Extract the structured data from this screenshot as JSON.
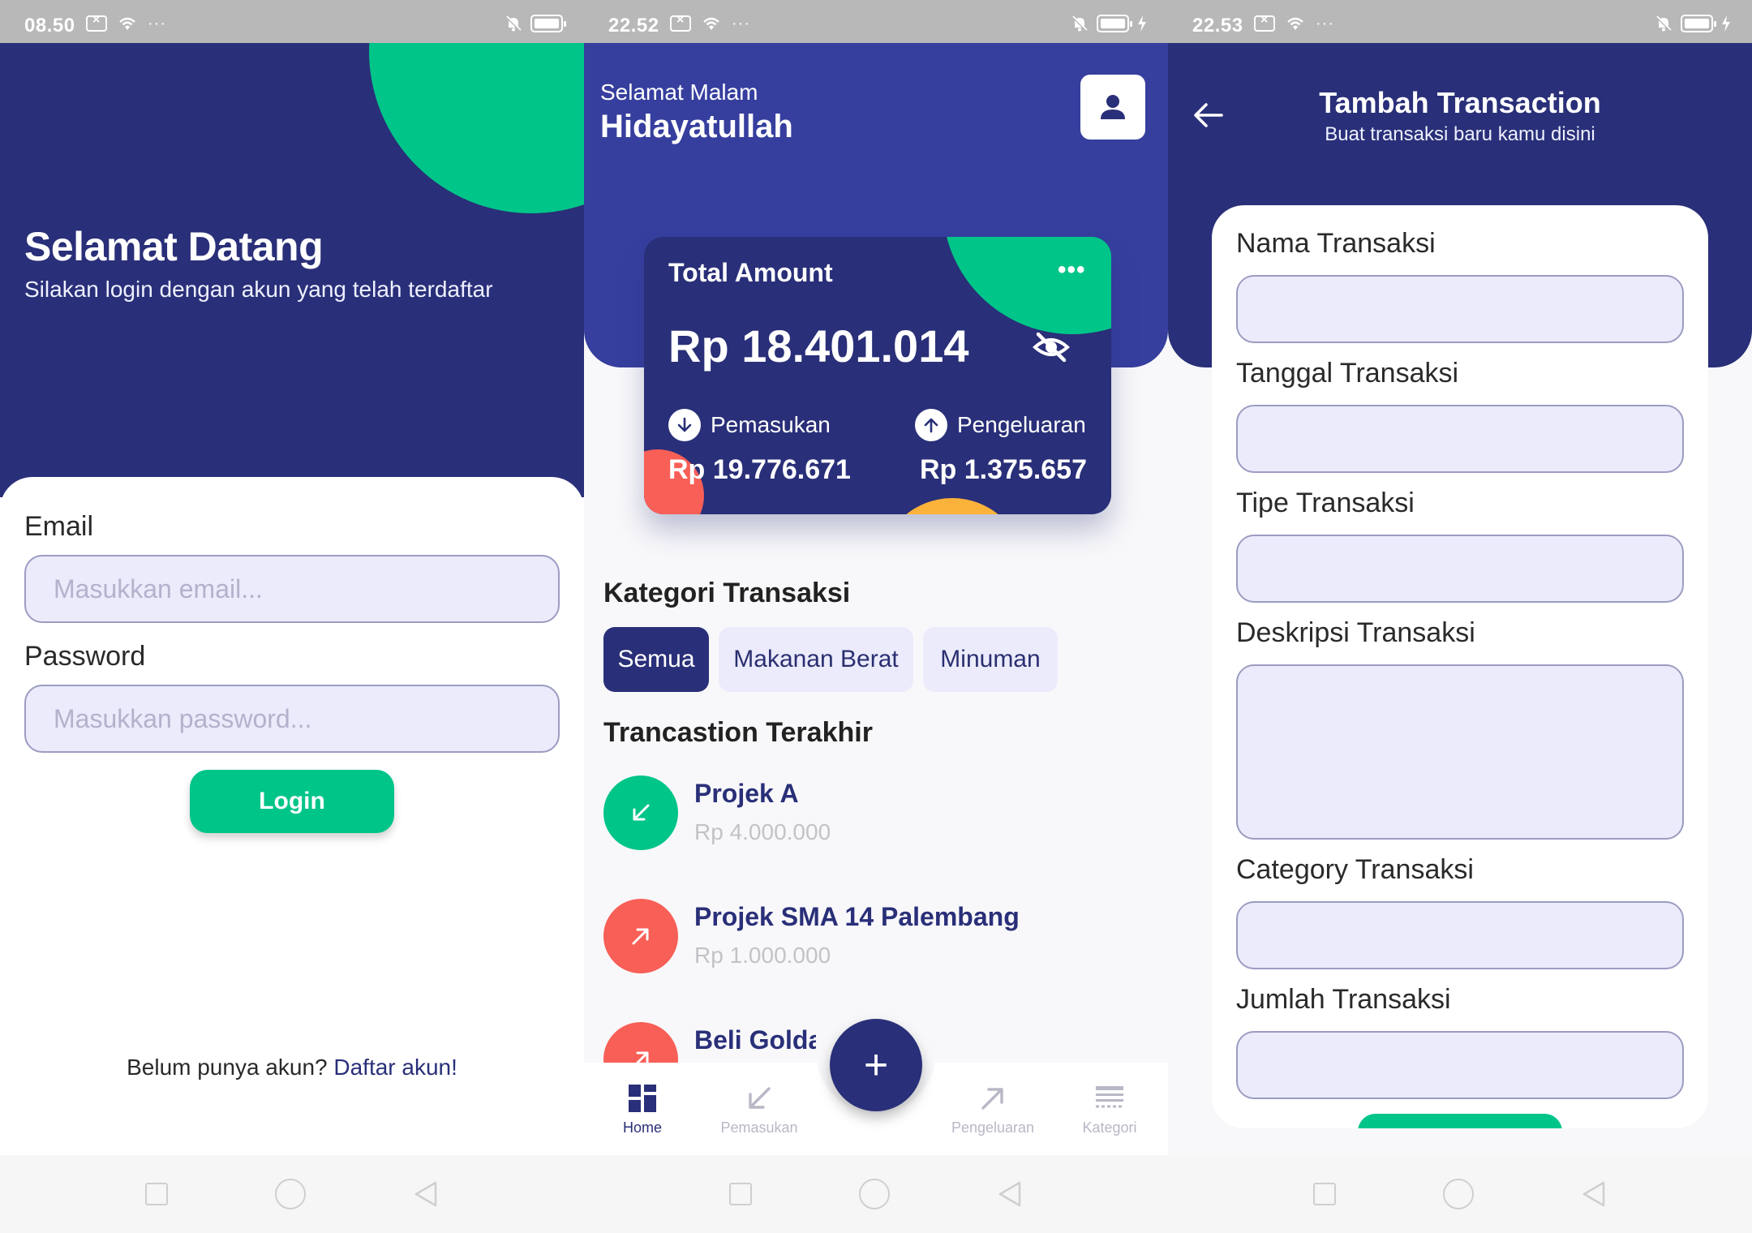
{
  "screen1": {
    "status": {
      "time": "08.50"
    },
    "title": "Selamat Datang",
    "subtitle": "Silakan login dengan akun yang telah terdaftar",
    "email": {
      "label": "Email",
      "placeholder": "Masukkan email..."
    },
    "password": {
      "label": "Password",
      "placeholder": "Masukkan password..."
    },
    "login_label": "Login",
    "footer": {
      "text": "Belum punya akun? ",
      "link": "Daftar akun!"
    }
  },
  "screen2": {
    "status": {
      "time": "22.52"
    },
    "greeting": "Selamat Malam",
    "name": "Hidayatullah",
    "card": {
      "title": "Total Amount",
      "more": "•••",
      "amount": "Rp 18.401.014",
      "income_label": "Pemasukan",
      "income_value": "Rp 19.776.671",
      "expense_label": "Pengeluaran",
      "expense_value": "Rp 1.375.657"
    },
    "categories_title": "Kategori Transaksi",
    "chips": [
      "Semua",
      "Makanan Berat",
      "Minuman"
    ],
    "recent_title": "Trancastion Terakhir",
    "transactions": [
      {
        "title": "Projek A",
        "amount": "Rp 4.000.000",
        "type": "income"
      },
      {
        "title": "Projek SMA 14 Palembang",
        "amount": "Rp 1.000.000",
        "type": "expense"
      },
      {
        "title": "Beli Golda",
        "amount": "",
        "type": "expense"
      }
    ],
    "tabs": [
      "Home",
      "Pemasukan",
      "Pengeluaran",
      "Kategori"
    ],
    "fab": "+"
  },
  "screen3": {
    "status": {
      "time": "22.53"
    },
    "title": "Tambah Transaction",
    "subtitle": "Buat transaksi baru kamu disini",
    "fields": [
      "Nama Transaksi",
      "Tanggal Transaksi",
      "Tipe Transaksi",
      "Deskripsi Transaksi",
      "Category Transaksi",
      "Jumlah Transaksi"
    ]
  },
  "colors": {
    "navy": "#292f78",
    "blue": "#363f9e",
    "green": "#00c589",
    "red": "#f85f57",
    "yellow": "#fbb23a",
    "input_bg": "#ebebfc"
  },
  "icons": {
    "status": [
      "notification-box-icon",
      "wifi-icon",
      "more-dots-icon",
      "mute-bell-icon",
      "battery-icon",
      "charging-icon"
    ],
    "screen2": [
      "person-icon",
      "eye-off-icon",
      "arrow-down-icon",
      "arrow-up-icon",
      "arrow-down-left-icon",
      "arrow-up-right-icon",
      "grid-icon",
      "list-icon"
    ],
    "screen3": [
      "back-arrow-icon"
    ]
  }
}
